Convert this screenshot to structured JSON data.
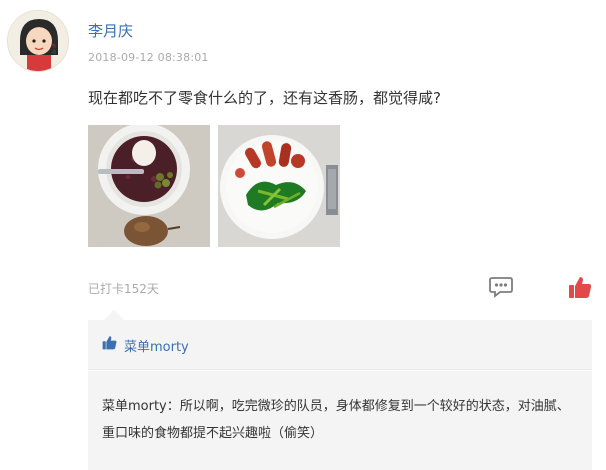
{
  "post": {
    "username": "李月庆",
    "timestamp": "2018-09-12 08:38:01",
    "text": "现在都吃不了零食什么的了，还有这香肠，都觉得咸?",
    "checkin": "已打卡152天"
  },
  "icons": {
    "avatar": "cartoon-girl-avatar",
    "comment": "comment-bubble-icon",
    "like": "thumbs-up-icon"
  },
  "likes": {
    "names": "菜单morty"
  },
  "comment": {
    "author": "菜单morty：",
    "text": "所以啊，吃完微珍的队员，身体都修复到一个较好的状态，对油腻、重口味的食物都提不起兴趣啦（偷笑）"
  },
  "colors": {
    "link": "#3a6fb5",
    "like": "#e24a4a",
    "muted": "#aaaaaa",
    "panel": "#f4f4f4"
  }
}
